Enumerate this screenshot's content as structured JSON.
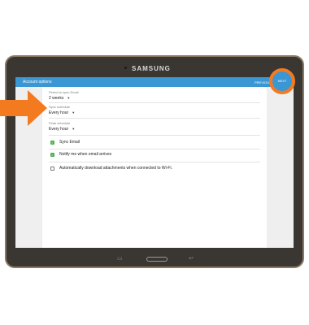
{
  "device": {
    "brand": "SAMSUNG"
  },
  "appbar": {
    "title": "Account options",
    "previous_label": "PREVIOUS",
    "next_label": "NEXT"
  },
  "settings": [
    {
      "label": "Period to sync Email",
      "value": "2 weeks"
    },
    {
      "label": "Sync schedule",
      "value": "Every hour"
    },
    {
      "label": "Peak schedule",
      "value": "Every hour"
    }
  ],
  "checkboxes": [
    {
      "label": "Sync Email",
      "checked": true
    },
    {
      "label": "Notify me when email arrives",
      "checked": true
    },
    {
      "label": "Automatically download attachments when connected to Wi-Fi.",
      "checked": false
    }
  ],
  "colors": {
    "appbar": "#3a97d4",
    "highlight": "#f47a1f",
    "arrow": "#f47a1f",
    "check": "#4caf50"
  },
  "icons": {
    "dropdown": "caret-down-icon",
    "recent": "recent-apps-icon",
    "back": "back-icon"
  }
}
